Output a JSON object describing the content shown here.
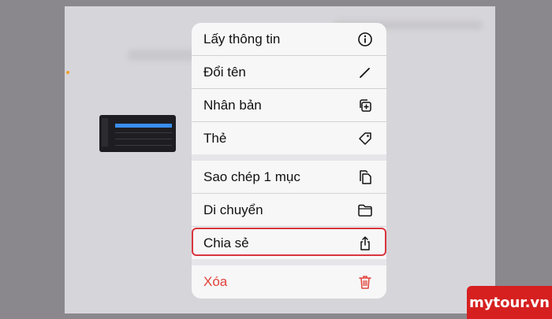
{
  "menu": {
    "items": [
      {
        "label": "Lấy thông tin",
        "icon": "info-icon"
      },
      {
        "label": "Đổi tên",
        "icon": "pencil-icon"
      },
      {
        "label": "Nhân bản",
        "icon": "duplicate-icon"
      },
      {
        "label": "Thẻ",
        "icon": "tag-icon"
      },
      {
        "label": "Sao chép 1 mục",
        "icon": "copy-icon"
      },
      {
        "label": "Di chuyển",
        "icon": "folder-icon"
      },
      {
        "label": "Chia sẻ",
        "icon": "share-icon"
      },
      {
        "label": "Xóa",
        "icon": "trash-icon"
      }
    ]
  },
  "highlighted_item": "Chia sẻ",
  "watermark": "mytour.vn",
  "colors": {
    "danger": "#e0433a",
    "highlight": "#d8363f",
    "watermark_bg": "#d62020"
  }
}
